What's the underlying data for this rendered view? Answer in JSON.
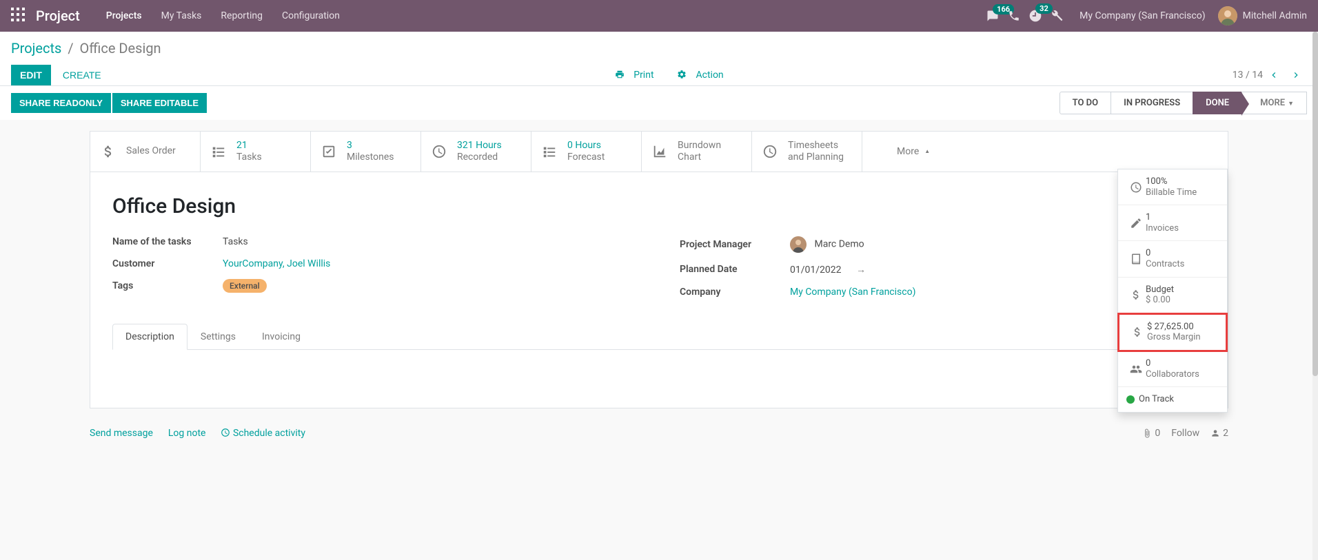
{
  "topbar": {
    "brand": "Project",
    "nav": [
      "Projects",
      "My Tasks",
      "Reporting",
      "Configuration"
    ],
    "msg_count": "166",
    "activity_count": "32",
    "company": "My Company (San Francisco)",
    "user": "Mitchell Admin"
  },
  "breadcrumb": {
    "root": "Projects",
    "sep": "/",
    "current": "Office Design"
  },
  "buttons": {
    "edit": "EDIT",
    "create": "CREATE",
    "print": "Print",
    "action": "Action",
    "share_ro": "SHARE READONLY",
    "share_rw": "SHARE EDITABLE"
  },
  "pager": {
    "text": "13 / 14"
  },
  "stages": {
    "todo": "TO DO",
    "progress": "IN PROGRESS",
    "done": "DONE",
    "more": "MORE"
  },
  "stats": {
    "sales_order": {
      "label": "Sales Order"
    },
    "tasks": {
      "value": "21",
      "label": "Tasks"
    },
    "milestones": {
      "value": "3",
      "label": "Milestones"
    },
    "recorded": {
      "value": "321 Hours",
      "label": "Recorded"
    },
    "forecast": {
      "value": "0 Hours",
      "label": "Forecast"
    },
    "burndown": {
      "label1": "Burndown",
      "label2": "Chart"
    },
    "timesheets": {
      "label1": "Timesheets",
      "label2": "and Planning"
    },
    "more": "More"
  },
  "dropdown": {
    "billable": {
      "value": "100%",
      "label": "Billable Time"
    },
    "invoices": {
      "value": "1",
      "label": "Invoices"
    },
    "contracts": {
      "value": "0",
      "label": "Contracts"
    },
    "budget": {
      "value": "Budget",
      "label": "$ 0.00"
    },
    "margin": {
      "value": "$ 27,625.00",
      "label": "Gross Margin"
    },
    "collab": {
      "value": "0",
      "label": "Collaborators"
    },
    "track": {
      "label": "On Track"
    }
  },
  "project": {
    "title": "Office Design",
    "labels": {
      "task_name": "Name of the tasks",
      "customer": "Customer",
      "tags": "Tags",
      "manager": "Project Manager",
      "planned": "Planned Date",
      "company": "Company"
    },
    "task_name_val": "Tasks",
    "customer": "YourCompany, Joel Willis",
    "tag": "External",
    "manager": "Marc Demo",
    "planned_date": "01/01/2022",
    "company": "My Company (San Francisco)"
  },
  "tabs": [
    "Description",
    "Settings",
    "Invoicing"
  ],
  "chatter": {
    "send": "Send message",
    "log": "Log note",
    "sched": "Schedule activity",
    "attach": "0",
    "follow": "Follow",
    "followers": "2"
  }
}
